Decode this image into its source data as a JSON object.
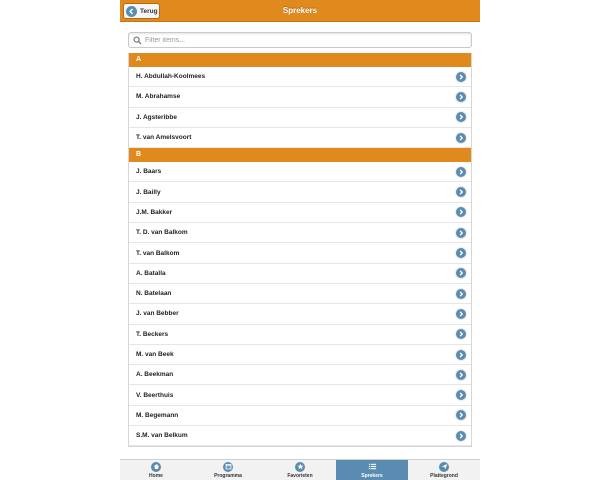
{
  "header": {
    "title": "Sprekers",
    "back_label": "Terug"
  },
  "filter": {
    "placeholder": "Filter items..."
  },
  "sections": [
    {
      "letter": "A",
      "items": [
        "H. Abdullah-Koolmees",
        "M. Abrahamse",
        "J. Agsteribbe",
        "T. van Amelsvoort"
      ]
    },
    {
      "letter": "B",
      "items": [
        "J. Baars",
        "J. Bailly",
        "J.M. Bakker",
        "T. D. van Balkom",
        "T. van Balkom",
        "A. Batalla",
        "N. Batelaan",
        "J. van Bebber",
        "T. Beckers",
        "M. van Beek",
        "A. Beekman",
        "V. Beerthuis",
        "M. Begemann",
        "S.M. van Belkum"
      ]
    }
  ],
  "tabs": [
    {
      "label": "Home",
      "icon": "home-icon",
      "active": false
    },
    {
      "label": "Programma",
      "icon": "calendar-icon",
      "active": false
    },
    {
      "label": "Favorieten",
      "icon": "star-icon",
      "active": false
    },
    {
      "label": "Sprekers",
      "icon": "list-icon",
      "active": true
    },
    {
      "label": "Plattegrond",
      "icon": "map-icon",
      "active": false
    }
  ],
  "colors": {
    "accent": "#e08a1e",
    "icon_blue": "#5a8bb0"
  }
}
